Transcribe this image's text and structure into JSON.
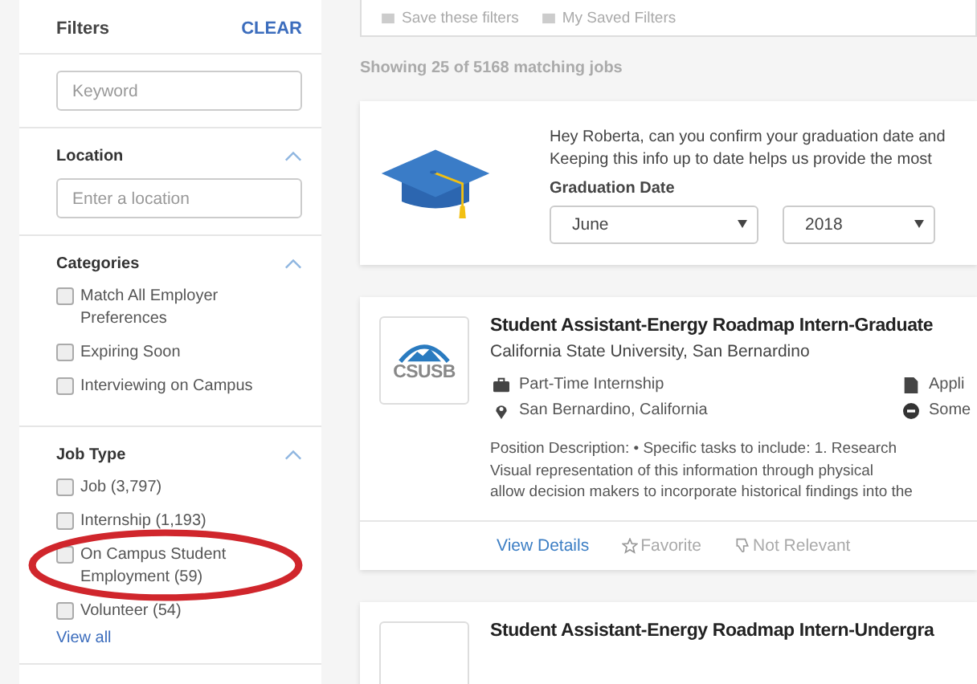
{
  "sidebar": {
    "title": "Filters",
    "clear": "CLEAR",
    "keyword": {
      "placeholder": "Keyword"
    },
    "sections": [
      {
        "kind": "input",
        "title": "Location",
        "expanded": true,
        "placeholder": "Enter a location"
      },
      {
        "kind": "checks",
        "title": "Categories",
        "expanded": true,
        "items": [
          {
            "label": "Match All Employer Preferences",
            "checked": false,
            "circled": false
          },
          {
            "label": "Expiring Soon",
            "checked": false,
            "circled": false
          },
          {
            "label": "Interviewing on Campus",
            "checked": false,
            "circled": false
          }
        ]
      },
      {
        "kind": "checks",
        "title": "Job Type",
        "expanded": true,
        "items": [
          {
            "label": "Job (3,797)",
            "checked": false,
            "circled": false
          },
          {
            "label": "Internship (1,193)",
            "checked": false,
            "circled": false
          },
          {
            "label": "On Campus Student Employment (59)",
            "checked": false,
            "circled": true
          },
          {
            "label": "Volunteer (54)",
            "checked": false,
            "circled": false
          }
        ],
        "more": "View all"
      }
    ]
  },
  "toolbar": [
    "Save these filters",
    "My Saved Filters"
  ],
  "result_count": "Showing 25 of 5168 matching jobs",
  "graduation_card": {
    "lines": [
      "Hey Roberta, can you confirm your graduation date and",
      "Keeping this info up to date helps us provide the most"
    ],
    "label": "Graduation Date",
    "month": "June",
    "year": "2018"
  },
  "jobs": [
    {
      "logo": "CSUSB",
      "title": "Student Assistant-Energy Roadmap Intern-Graduate",
      "employer": "California State University, San Bernardino",
      "meta": [
        {
          "kind": "type",
          "text": "Part-Time Internship"
        },
        {
          "kind": "document",
          "text": "Appli"
        },
        {
          "kind": "location",
          "text": "San Bernardino, California"
        },
        {
          "kind": "blocked",
          "text": "Some"
        }
      ],
      "description": [
        "Position Description:   • Specific tasks to include:   1. Research",
        "Visual representation of this information through physical",
        "allow decision makers to incorporate historical findings into the"
      ],
      "actions": [
        "View Details",
        "Favorite",
        "Not Relevant"
      ]
    },
    {
      "title": "Student Assistant-Energy Roadmap Intern-Undergra"
    }
  ]
}
